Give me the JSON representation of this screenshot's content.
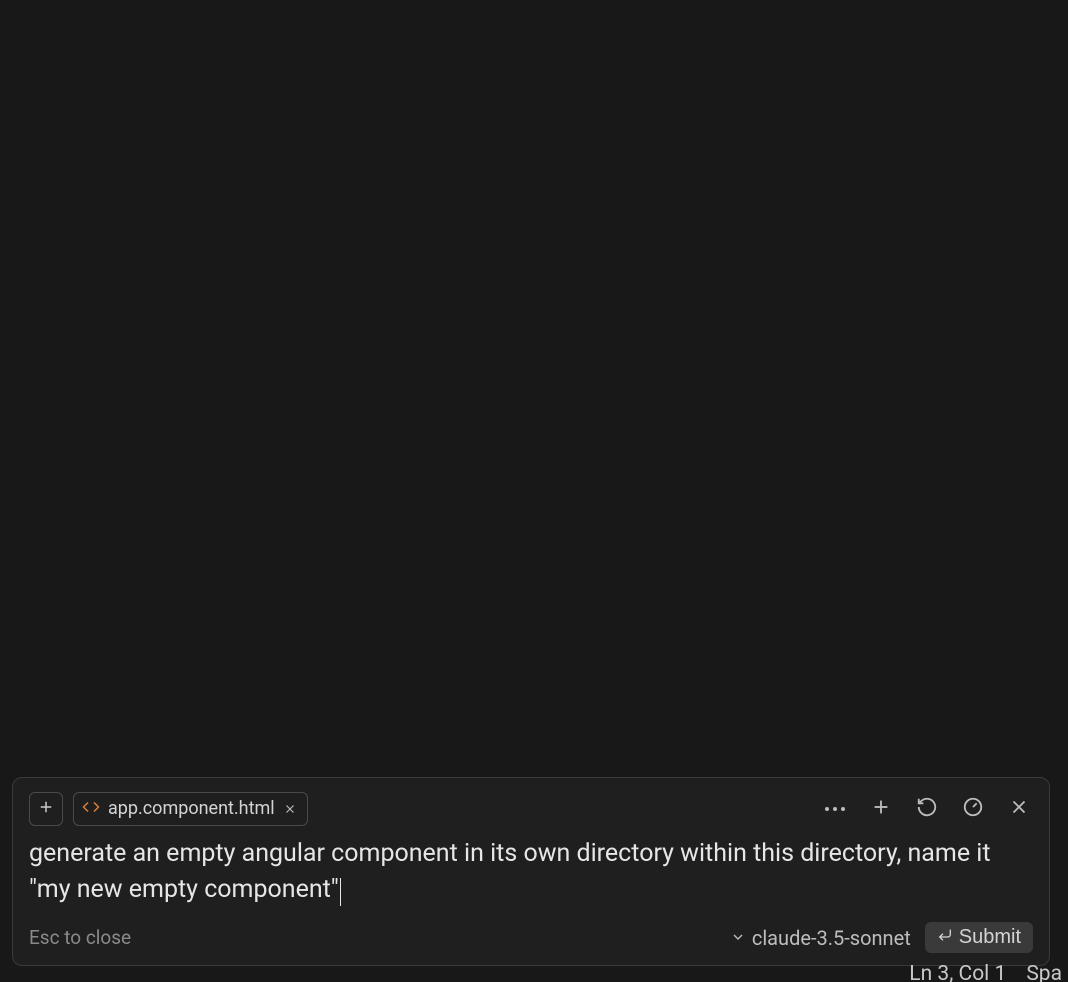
{
  "panel": {
    "chip": {
      "filename": "app.component.html"
    },
    "prompt_text": "generate an empty angular component in its own directory within this directory, name it \"my new empty component\"",
    "hint": "Esc to close",
    "model": "claude-3.5-sonnet",
    "submit_label": "Submit"
  },
  "status_bar": {
    "position": "Ln 3, Col 1",
    "indent": "Spa"
  },
  "icons": {
    "plus": "plus-icon",
    "code": "code-icon",
    "close": "close-icon",
    "more": "more-icon",
    "refresh": "refresh-icon",
    "gauge": "gauge-icon",
    "chevron_down": "chevron-down-icon",
    "enter": "enter-icon"
  }
}
